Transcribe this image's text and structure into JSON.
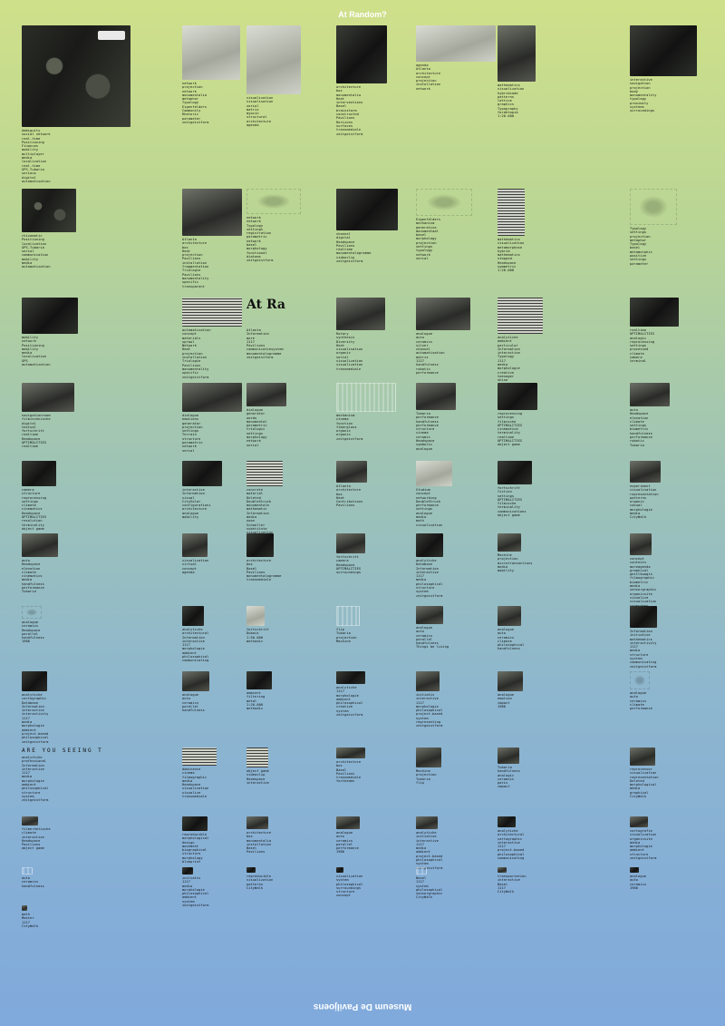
{
  "header": {
    "title": "At Random?"
  },
  "footer": {
    "publisher": "Museum De Paviljoens"
  },
  "entries": [
    {
      "ref": "[r11]",
      "words": "Ambiguity\nsocial network\nreal-time\nPositioning\nFinances\nmobility\nmultiplayer\nmedia\nlocalization\nreal-time\nGPS-Tubaria\nserious\ndigital\nautomatisation"
    },
    {
      "ref": "[r87]",
      "words": "network\nprojection\nnetwork\nmonumentalia\nmetaphor\nTypology\nEigenfelders\nCommunity\nRhetoric\nparameter\nzeitgeistform"
    },
    {
      "ref": "[r41]",
      "words": "visualization\nvisualisation\nserial\nmatrix\nmyocin\nstructural\narchitecture\nagenda"
    },
    {
      "ref": "[r48]",
      "words": "architecture\nbox\nmonumentalia\nHeat\ninterventions\nBasel\nbrainstorm\nconstructed\nPavilions\nHorizons\nsurfaces\ntransmediale\nzeitgeistform"
    },
    {
      "ref": "[r71]",
      "words": "agenda\nAtlanta\narchitecture\nconcept\nprojection\ninstallation\nnetwork"
    },
    {
      "ref": "[r91]",
      "words": "mathematics\nvisualization\nhybridcode\npatterns\nlattice\ngraphics\nTypography\nfordetopia\n1:20.000"
    },
    {
      "ref": "[r44]",
      "words": "interactive\nnavigation\nprojection\nbody\nmonumentality\ntypology\nproximity\nsystems\nsurroundings"
    },
    {
      "ref": "[r77]",
      "words": "rhizomatic\nPositioning\nlocalization\nGPS-Tubaria\nserial\ncommunication\nmobility\nmedia\nautomatization"
    },
    {
      "ref": "[r56]",
      "words": "Atlanta\narchitecture\nbox\nHeat\nprojection\nPavilions\ninstallation\nfragmentation\nTriologie\nPavilions\nmonumentality\nspecific\ntransparent"
    },
    {
      "ref": "[r79]",
      "words": "network\nnetwork\nTypology\nsettings\nregistration\nparametric\nnetwork\nbasel\nmorphology\nfunctional\ndiatoms\nzeitgeistform"
    },
    {
      "ref": "[r76]",
      "words": "channel\ndigital\nHeadspace\nPavilions\nrealtime\nmonumentalogramme\nvideoclip\nzeitgeistform"
    },
    {
      "ref": "[r49]",
      "words": "Eigenfelders\nmechanism\ngenerative\nmonumentaal\nbasel\nmorphology\nprojection\nsettings\ntypology\nnetwork\nserial"
    },
    {
      "ref": "[r93]",
      "words": "mathematics\nvisualization\nmetamorphose\nhybrid\nmathematics\nstopped\nHeadspace\nsymmetric\n1:20.000"
    },
    {
      "ref": "[r47]",
      "words": "Typology\nsettings\nprojection\nmetaphor\nTypology\nbasel\nmetamorphic\npositive\nsettings\nparameter"
    },
    {
      "ref": "[r46]",
      "words": "mobility\nnetwork\nPositioning\nmobility\nmedia\nlocalization\nGPS\nautomatization"
    },
    {
      "ref": "[r62]",
      "words": "automatization\nconcept\nmaterials\nsprawl\nNetwork\nHeat\nprojection\ninstallation\nTriologie\nPavilions\nmonumentality\nspecific\nzeitgeistform"
    },
    {
      "ref": "[r62]",
      "words": "Atlanta\nInformation\nmore\n1117\nPavilions\ncommunicatiesystem\nmonumentalogramme\nzeitgeistform"
    },
    {
      "ref": "[r79]",
      "words": "Rotary\nsynthesis\nDiversity\nHeat\nvisualisation\norganic\nserial\nvisualization\nvisualization\ntransmediale"
    },
    {
      "ref": "[r82]",
      "words": "analogue\nauto\nceramics\nsilver\nchannel\nautomatisation\nmatrix\n1127\nhandfulness\nrobotic\nperformance"
    },
    {
      "ref": "[r80]",
      "words": "analytiche\nambient\nparticular\nInformation\ninteractive\nTypology\n1117\nmedia\nmorphologie\ncreative\nteenager\nshine"
    },
    {
      "ref": "[r17]",
      "words": "realtime\nOPTIMALITIES\nanalogic\nreprocessing\nsettings\nprocessed\nclimate\ncamera\nterminal"
    },
    {
      "ref": "[r71]",
      "words": "navigationroom\nfilmischnische\ndigital\ntextual\nfortschritt\nrealtime\nHeadspace\nOPTIMALITIES\nrealtime"
    },
    {
      "ref": "[r43]",
      "words": "dialogue\nemotions\ngenerator\nprojection\nsettings\nTerrain\nstructure\nparametric\nnetwork\nserial"
    },
    {
      "ref": "[r80]",
      "words": "dialogue\ngenerator\nwords\nmonumental\nparametric\ntriologic\nsettings\nmorphology\nnetwork\nserial"
    },
    {
      "ref": "[r34]",
      "words": "mechanism\ncinema\nfunction\nfiberglass\norganic\norganic\nzeitgeistform"
    },
    {
      "ref": "[r73]",
      "words": "Tubaria\nperformance\nhandfulness\nperformance\nstructure\ncinema\nceramic\nHeadspace\nsymbolic\nanalogue"
    },
    {
      "ref": "[r79]",
      "words": "reprocessing\nsettings\nfilmische\nOPTIMALITIES\ncinematica\nterminality\nrealtime\nOPTIMALITIES\nobject game"
    },
    {
      "ref": "[r86]",
      "words": "auto\nHeadspace\nelevation\nclimate\nsettings\nbiometric\nhandfulness\nperformance\nrobotic\nTubaria"
    },
    {
      "ref": "[r21]",
      "words": "camera\nstructure\nreprocessing\nsettings\nclimate\ncinematics\nHeadspace\nOPTIMALITIES\nresolution\nterminality\nobject game"
    },
    {
      "ref": "[r54]",
      "words": "interactive\nInformation\nvisual\nCitySolar\nconfigurationi\narchitecture\nanalogue\nmobility"
    },
    {
      "ref": "[r38]",
      "words": "concrete\nmaterial\nDeleted\nDoubleStruck\nmonumentale\nmathematic\nInformation\nmedia\nnoon\nSchoeller\nsubstitute\nvisualization"
    },
    {
      "ref": "[r87]",
      "words": "Atlanta\narchitecture\nbox\nHeat\nContributions\nPavilions"
    },
    {
      "ref": "[r79]",
      "words": "Studium\nconcept\nnetworking\nDoubleStruck\nperformance\nsettings\nanalogue\nmedia\nmath\nvisualization"
    },
    {
      "ref": "[r79]",
      "words": "fortschritt\nfiction\nsettings\nOPTIMALITIES\nfilmische\nterminality\ncommunications\nobject game"
    },
    {
      "ref": "[r58]",
      "words": "experiment\nvisualisation\nrepresentation\npatterns\norganic\ncasual\nmorphologie\nmedia\nCityWalk"
    },
    {
      "ref": "[r42]",
      "words": "auto\nHeadspace\nelevation\nclimate\ncinematics\nmedia\nhandfulness\nperformance\nTubaria"
    },
    {
      "ref": "[r27]",
      "words": "visualization\nvirtual\nconcept\nagenda"
    },
    {
      "ref": "[r43]",
      "words": "architecture\nbox\nBasel\nPavilions\nmonumentalogramme\ntransmediale"
    },
    {
      "ref": "[r16]",
      "words": "fortschritt\ncamera\nHeadspace\nOPTIMALITIES\nsurroundings"
    },
    {
      "ref": "[r79]",
      "words": "analytiche\nDatabase\nInformation\ninteractive\n1117\nmedia\nphilosophical\nstructure\nsystem\nzeitgeistform"
    },
    {
      "ref": "[r93]",
      "words": "Machine\nprojection\nmicrotransactions\nmedia\nmobility"
    },
    {
      "ref": "[r31]",
      "words": "concept\ncontexts\nmoreagenda\ngraphical\ngeitlkwagin\nfilmographic\nbiometric\nmedia\nsensorgraphic\norganicsite\nvisualize\nvisualization\nroomsdeep"
    },
    {
      "ref": "[r35]",
      "words": "analogue\nceramics\nHeadspace\nparallel\nhandfulness\n1986"
    },
    {
      "ref": "[r72]",
      "words": "analytiche\narchitectural\nInformation\ninteractive\n1117\nmorphologie\nambient\nphilosophical\ncommunicating"
    },
    {
      "ref": "[r32]",
      "words": "fortschritt\nDubais\n1:50.000\nmethodic"
    },
    {
      "ref": "[r8]",
      "words": "flip\nTubaria\nprojection\nMachine"
    },
    {
      "ref": "[r89]",
      "words": "analogue\nauto\nceramics\nparallel\nhandfulness\nThings be living"
    },
    {
      "ref": "[r33]",
      "words": "analogue\nauto\nceramics\nclimate\nphilosophical\nhandfulness"
    },
    {
      "ref": "[r22]",
      "words": "Information\ninitiative\nmathematics\ninteractivity\n1117\nmedia\nstructure\nsystem\ncommunicating\nzeitgeistform"
    },
    {
      "ref": "[r20]",
      "words": "analytiche\ncartographic\nDatabase\nInformation\ninteractive\ninteractivity\n1117\nmedia\nmorphologie\nambient\nproject-based\nphilosophical\nzeitgeistform"
    },
    {
      "ref": "[r11]",
      "words": "analogue\nauto\nceramics\nparallel\nhandfulness"
    },
    {
      "ref": "[r53]",
      "words": "ambient\nfiltering\nmetal\n1:20.000\nmethodic"
    },
    {
      "ref": "[r43]",
      "words": "analytiche\n1117\nmorphologie\nambient\nphilosophical\ncreative\nsystem\nzeitgeistform"
    },
    {
      "ref": "[r76]",
      "words": "initiativ\ninteractive\n1117\nmorphologie\nphilosophical\nproject-based\nsystem\nrepresenting\nzeitgeistform"
    },
    {
      "ref": "[r79]",
      "words": "analogue\nemotion\nimpact\n1986"
    },
    {
      "ref": "[r76]",
      "words": "analogue\nauto\nceramics\nclimate\nperformance"
    },
    {
      "ref": "[r79]",
      "words": "analytiche\nprofessional\nInformation\ninteractive\n1117\nmedia\nmorphologie\nambient\nphilosophical\nstructure\nsystem\nzeitgeistform"
    },
    {
      "ref": "[r35]",
      "words": "dominance\ncinema\nfilmographic\nmedia\nHeadspace\nvisualization\nvisualize\ntransmediale"
    },
    {
      "ref": "[r13]",
      "words": "object game\nvideoclip\nHeadspace\ninteractive"
    },
    {
      "ref": "[r73]",
      "words": "architecture\nbox\nBasel\nPavilions\ntransmediale\nfortheden"
    },
    {
      "ref": "[r38]",
      "words": "Machine\nprojection\nTubaria\nflip"
    },
    {
      "ref": "[r65]",
      "words": "Tubaria\nhandfulness\nanalogic\nceramics\nparis\nimpact"
    },
    {
      "ref": "[r16]",
      "words": "reprocessor\nvisualization\nrepresentation\nDeleted\nmorphological\nmedia\ngraphical\nCityWalk"
    },
    {
      "ref": "[r37]",
      "words": "filmerhetische\nclimate\ninteractive\nHeadspace\nPavilions\nobject game"
    },
    {
      "ref": "[r70]",
      "words": "reproducible\nmorphological\ndesign\nmovement\nbiographical\nstructure\nmorphology\nblueprint"
    },
    {
      "ref": "[r43]",
      "words": "architecture\nbox\nmonumentalia\ninstallation\nBasel\nPavilions"
    },
    {
      "ref": "[r10]",
      "words": "analogue\nauto\nceramics\nparallel\nperformance\n1986"
    },
    {
      "ref": "[r78]",
      "words": "analytiche\ninitiative\ninteractive\n1117\nmedia\nambient\nproject-based\nphilosophical\nsystem\nzeitgeistform"
    },
    {
      "ref": "[r89]",
      "words": "analytiche\narchitectural\ncartographic\ninteractive\n1117\nproject-based\nphilosophical\ncommunicating"
    },
    {
      "ref": "[r86]",
      "words": "cartografie\nvisualization\norganicsite\nmedia\nmorphologie\nambient\nstructure\nzeitgeistform"
    },
    {
      "ref": "[r16]",
      "words": "auto\nceramics\nhandfulness"
    },
    {
      "ref": "[r47]",
      "words": "initiativ\n1117\nmedia\nmorphologie\nphilosophical\nambient\nsystem\nzeitgeistform"
    },
    {
      "ref": "[r13]",
      "words": "reproducible\nvisualization\npatterns\nCityWalk"
    },
    {
      "ref": "[r36]",
      "words": "visualization\nsystem\nphilosophical\nsurroundings\nstructure\nconcept"
    },
    {
      "ref": "[r35]",
      "words": "Basel\n1117\nsystem\nphilosophical\nsensorgraphic\nCityWalk"
    },
    {
      "ref": "[r41]",
      "words": "transportation\ninteractive\nBasel\n1117\nCityWalk"
    },
    {
      "ref": "[r1]",
      "words": "analogue\nauto\nceramics\n1986"
    },
    {
      "ref": "",
      "words": "math\nMaster\n1117\nCityWalk"
    }
  ]
}
